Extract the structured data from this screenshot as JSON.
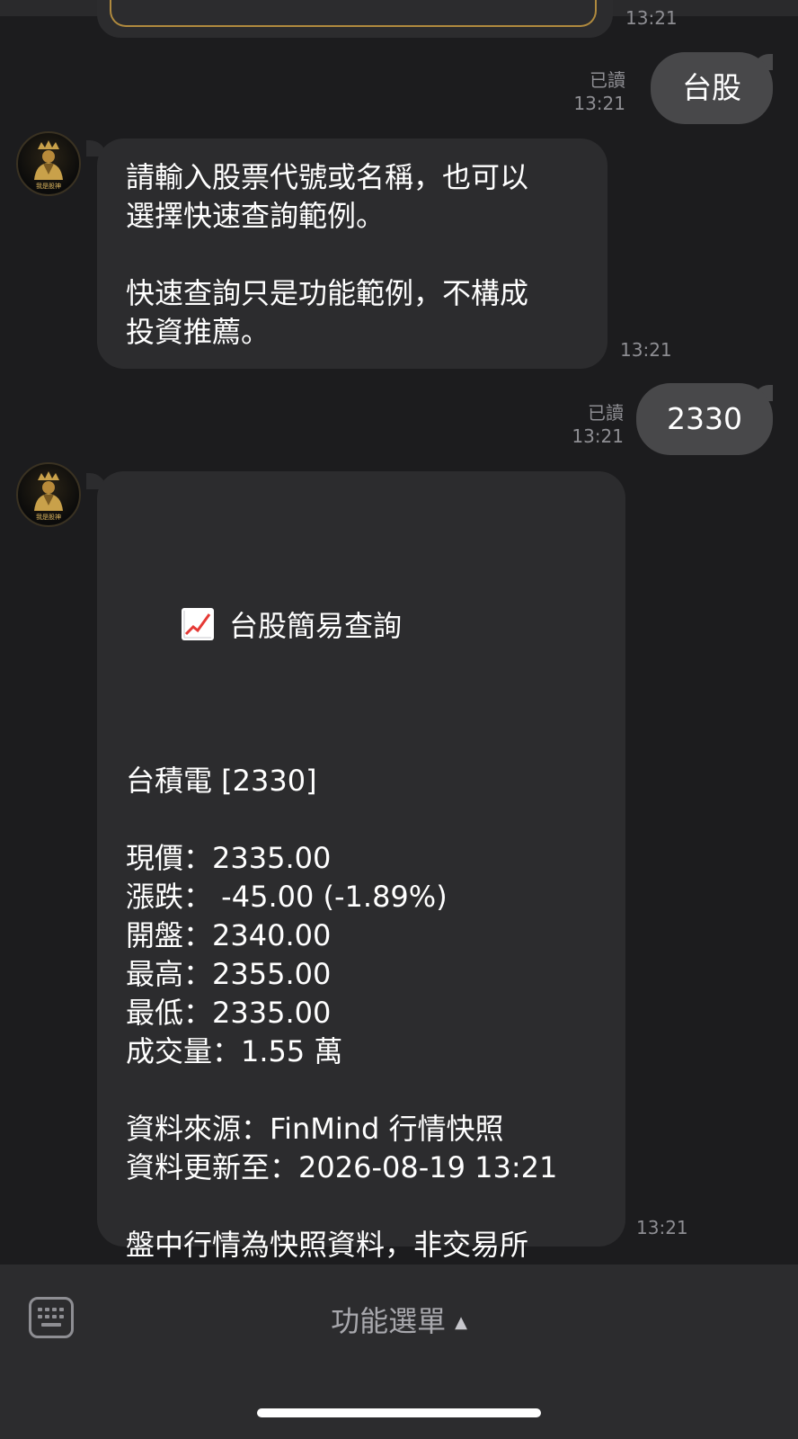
{
  "prev_message": {
    "time": "13:21"
  },
  "bot": {
    "avatar_text": "我是股神"
  },
  "messages": {
    "user1": {
      "text": "台股",
      "read": "已讀",
      "time": "13:21"
    },
    "bot1": {
      "text": "請輸入股票代號或名稱，也可以\n選擇快速查詢範例。\n\n快速查詢只是功能範例，不構成\n投資推薦。",
      "time": "13:21"
    },
    "user2": {
      "text": "2330",
      "read": "已讀",
      "time": "13:21"
    },
    "bot2": {
      "title": "台股簡易查詢",
      "body": "台積電 [2330]\n\n現價：2335.00\n漲跌： -45.00 (-1.89%)\n開盤：2340.00\n最高：2355.00\n最低：2335.00\n成交量：1.55 萬\n\n資料來源：FinMind 行情快照\n資料更新至：2026-08-19 13:21\n\n盤中行情為快照資料，非交易所\n官方即時報價。\n僅供市場觀察參考。\n\n需要再查一次，請重新點「台股」\n功能。",
      "time": "13:21"
    }
  },
  "bottom_bar": {
    "menu_label": "功能選單",
    "arrow": "▲"
  },
  "colors": {
    "background": "#1c1c1e",
    "bubble_in": "#2c2c2e",
    "bubble_out": "#48484a",
    "meta": "#8e8e93"
  }
}
